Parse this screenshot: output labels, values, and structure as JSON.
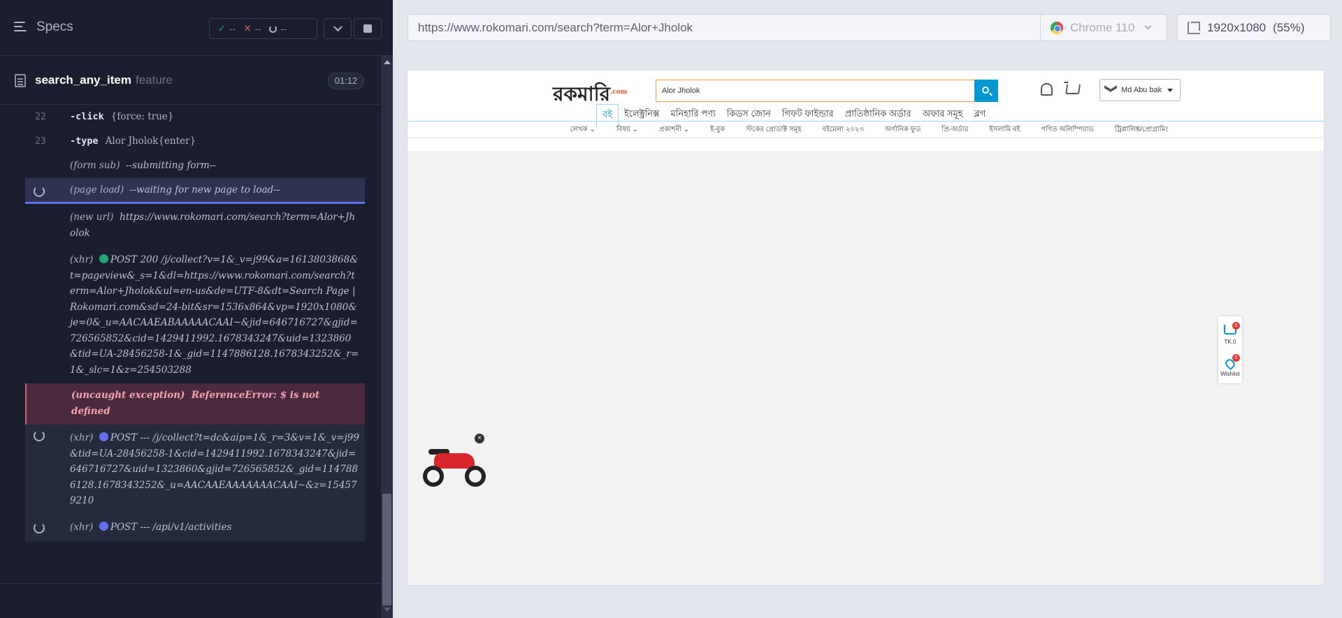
{
  "reporter": {
    "specs_label": "Specs",
    "stats": {
      "passed": "--",
      "failed": "--",
      "pending": "--"
    },
    "spec": {
      "name": "search_any_item",
      "ext": "feature",
      "timer": "01:12"
    },
    "commands": [
      {
        "num": "22",
        "name": "-click",
        "arg": "{force: true}"
      },
      {
        "num": "23",
        "name": "-type",
        "arg": "Alor Jholok{enter}"
      },
      {
        "label": "(form sub)",
        "msg": "--submitting form--"
      },
      {
        "label": "(page load)",
        "msg": "--waiting for new page to load--"
      },
      {
        "label": "(new url)",
        "msg": "https://www.rokomari.com/search?term=Alor+Jholok"
      },
      {
        "label": "(xhr)",
        "msg": "POST 200 /j/collect?v=1&_v=j99&a=1613803868&t=pageview&_s=1&dl=https://www.rokomari.com/search?term=Alor+Jholok&ul=en-us&de=UTF-8&dt=Search Page | Rokomari.com&sd=24-bit&sr=1536x864&vp=1920x1080&je=0&_u=AACAAEABAAAAACAAI~&jid=646716727&gjid=726565852&cid=1429411992.1678343247&uid=1323860&tid=UA-28456258-1&_gid=1147886128.1678343252&_r=1&_slc=1&z=254503288"
      },
      {
        "label": "(uncaught exception)",
        "msg": "ReferenceError: $ is not defined"
      },
      {
        "label": "(xhr)",
        "msg": "POST --- /j/collect?t=dc&aip=1&_r=3&v=1&_v=j99&tid=UA-28456258-1&cid=1429411992.1678343247&jid=646716727&uid=1323860&gjid=726565852&_gid=1147886128.1678343252&_u=AACAAEAAAAAAACAAI~&z=154579210"
      },
      {
        "label": "(xhr)",
        "msg": "POST --- /api/v1/activities"
      }
    ]
  },
  "aut": {
    "url": "https://www.rokomari.com/search?term=Alor+Jholok",
    "browser": "Chrome 110",
    "viewport": "1920x1080",
    "scale": "(55%)"
  },
  "site": {
    "logo": "রকমারি",
    "logo_suffix": ".com",
    "search_value": "Alor Jholok",
    "user": "Md Abu bak",
    "categories": [
      "বই",
      "ইলেক্ট্রনিক্স",
      "মনিহারি পণ্য",
      "কিডস জোন",
      "গিফট ফাইন্ডার",
      "প্রাতিষ্ঠানিক অর্ডার",
      "অফার সমূহ",
      "ব্লগ"
    ],
    "subnav": [
      "লেখক ⌄",
      "বিষয় ⌄",
      "প্রকাশনী ⌄",
      "ই-বুক",
      "স্টকের প্রোডাক্ট সমূহ",
      "বইমেলা ২০২৩",
      "অর্গানিক ফুড",
      "প্রি-অর্ডার",
      "ইসলামি বই",
      "গণিত অলিম্পিয়াড",
      "ট্রিপ্লালিঙ্ক/প্রোগ্রামিং"
    ],
    "widget": {
      "cart_count": "0",
      "cart_total": "TK.0",
      "wishlist_count": "0",
      "wishlist_label": "Wishlist"
    },
    "ad_close": "×"
  },
  "colors": {
    "accent": "#6470f3",
    "pass": "#1fa971",
    "fail": "#e45770",
    "site_blue": "#0397d3"
  }
}
